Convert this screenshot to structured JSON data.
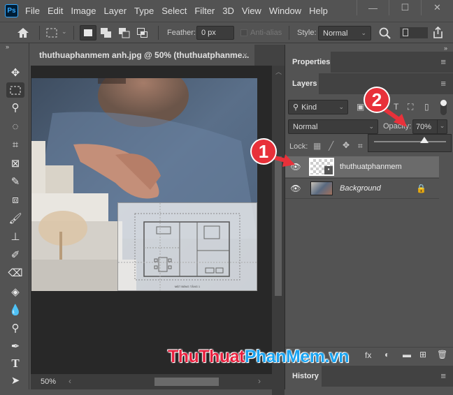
{
  "app": {
    "logo": "Ps"
  },
  "menu": [
    "File",
    "Edit",
    "Image",
    "Layer",
    "Type",
    "Select",
    "Filter",
    "3D",
    "View",
    "Window",
    "Help"
  ],
  "window_controls": {
    "minimize": "—",
    "maximize": "☐",
    "close": "✕"
  },
  "options": {
    "feather_label": "Feather:",
    "feather_value": "0 px",
    "antialias_label": "Anti-alias",
    "style_label": "Style:",
    "style_value": "Normal"
  },
  "document": {
    "tab_title": "thuthuaphanmem anh.jpg @ 50% (thuthuatphanme...",
    "tab_close": "×",
    "zoom": "50%",
    "plan_caption": "MẶT BẰNG TẦNG 1"
  },
  "panels": {
    "collapse": "»",
    "properties_title": "Properties",
    "layers_title": "Layers",
    "history_title": "History",
    "kind_label": "Kind",
    "blend_mode": "Normal",
    "opacity_label": "Opacity:",
    "opacity_value": "70%",
    "opacity_slider_fraction": 0.7,
    "lock_label": "Lock:",
    "layers": [
      {
        "name": "thuthuatphanmem",
        "italic": false,
        "selected": true,
        "locked": false
      },
      {
        "name": "Background",
        "italic": true,
        "selected": false,
        "locked": true
      }
    ]
  },
  "annotations": {
    "badge1": "1",
    "badge2": "2",
    "color": "#e8313a"
  },
  "watermark": {
    "part1": "ThuThuat",
    "part2": "PhanMem",
    "part3": ".vn",
    "color1": "#e8213f",
    "color2": "#1aa3f0"
  }
}
